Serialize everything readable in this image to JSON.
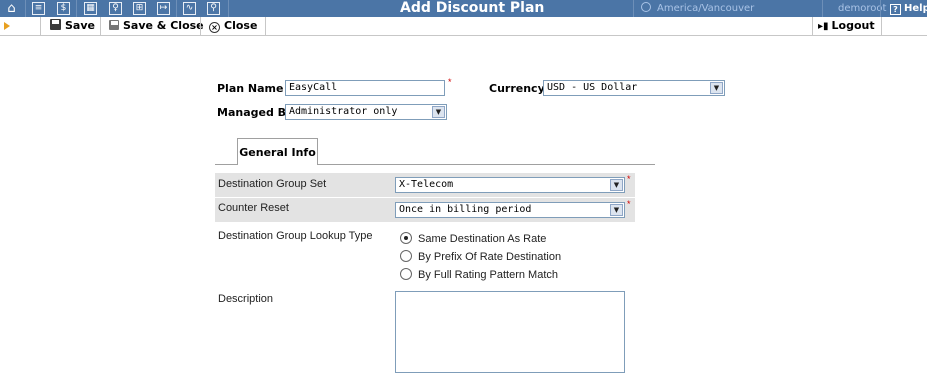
{
  "header": {
    "title": "Add Discount Plan",
    "timezone": "America/Vancouver",
    "user": "demoroot",
    "help_label": "Help",
    "nav_icons": [
      "home-icon",
      "list-icon",
      "dollar-icon",
      "grid-icon",
      "person-icon",
      "tree-icon",
      "flow-icon",
      "chart-icon",
      "search-icon"
    ]
  },
  "toolbar": {
    "save_label": "Save",
    "save_close_label": "Save & Close",
    "close_label": "Close",
    "logout_label": "Logout"
  },
  "form": {
    "plan_name_label": "Plan Name",
    "plan_name_value": "EasyCall",
    "currency_label": "Currency",
    "currency_value": "USD - US Dollar",
    "managed_by_label": "Managed By",
    "managed_by_value": "Administrator only"
  },
  "tabs": [
    {
      "label": "General Info"
    }
  ],
  "general_info": {
    "dest_group_set_label": "Destination Group Set",
    "dest_group_set_value": "X-Telecom",
    "counter_reset_label": "Counter Reset",
    "counter_reset_value": "Once in billing period",
    "lookup_type_label": "Destination Group Lookup Type",
    "lookup_options": [
      {
        "label": "Same Destination As Rate",
        "selected": true
      },
      {
        "label": "By Prefix Of Rate Destination",
        "selected": false
      },
      {
        "label": "By Full Rating Pattern Match",
        "selected": false
      }
    ],
    "description_label": "Description",
    "description_value": ""
  },
  "colors": {
    "header_bg": "#4b75a6",
    "required": "#d00000",
    "row_bg": "#e3e3e3"
  }
}
